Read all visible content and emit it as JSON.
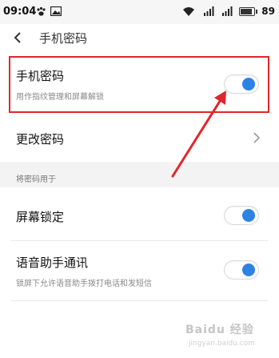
{
  "status_bar": {
    "time": "09:04",
    "battery_level": "89",
    "icons": [
      "paw-icon",
      "image-icon",
      "wifi-icon",
      "signal-icon",
      "signal-icon",
      "battery-icon"
    ]
  },
  "header": {
    "title": "手机密码",
    "back_icon": "chevron-left-icon"
  },
  "phone_password": {
    "title": "手机密码",
    "subtitle": "用作指纹管理和屏幕解锁",
    "enabled": true
  },
  "change_password": {
    "title": "更改密码",
    "icon": "chevron-right-icon"
  },
  "section": {
    "label": "将密码用于"
  },
  "screen_lock": {
    "title": "屏幕锁定",
    "enabled": true
  },
  "voice_assistant": {
    "title": "语音助手通讯",
    "subtitle": "锁屏下允许语音助手拨打电话和发短信",
    "enabled": true
  },
  "watermark": {
    "text": "Baidu 经验",
    "sub": "jingyan.baidu.com"
  },
  "colors": {
    "accent": "#2d82e6",
    "highlight": "#e0262b",
    "section_bg": "#f3f3f3"
  }
}
